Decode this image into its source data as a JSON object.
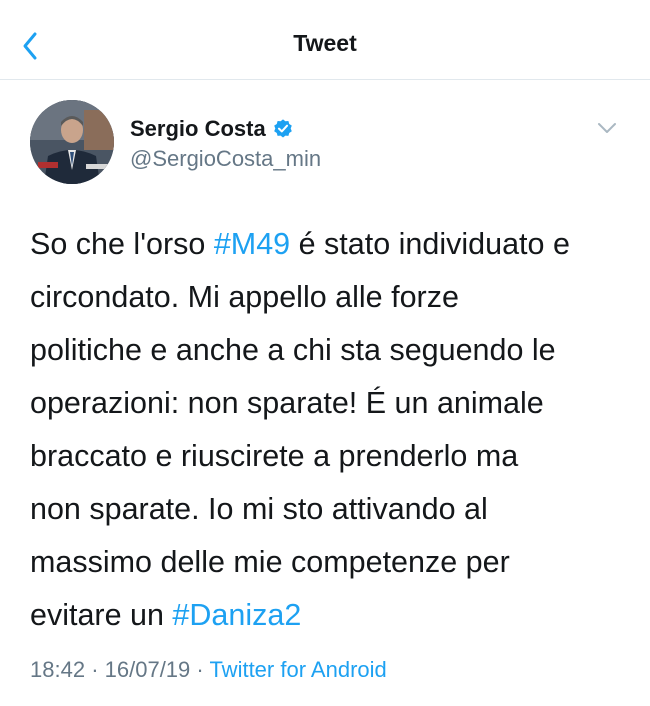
{
  "header": {
    "title": "Tweet"
  },
  "author": {
    "display_name": "Sergio Costa",
    "handle": "@SergioCosta_min",
    "verified": true
  },
  "tweet": {
    "lines": [
      {
        "pre": "So che l'orso ",
        "tag": "#M49",
        "post": " é stato individuato e"
      },
      {
        "pre": "circondato. Mi appello alle forze",
        "tag": "",
        "post": ""
      },
      {
        "pre": "politiche e anche a chi sta seguendo le",
        "tag": "",
        "post": ""
      },
      {
        "pre": "operazioni: non sparate! É un animale",
        "tag": "",
        "post": ""
      },
      {
        "pre": "braccato e riuscirete a prenderlo ma",
        "tag": "",
        "post": ""
      },
      {
        "pre": "non sparate. Io mi sto attivando al",
        "tag": "",
        "post": ""
      },
      {
        "pre": "massimo delle mie competenze per",
        "tag": "",
        "post": ""
      },
      {
        "pre": "evitare un ",
        "tag": "#Daniza2",
        "post": ""
      }
    ]
  },
  "meta": {
    "time": "18:42",
    "separator": "·",
    "date": "16/07/19",
    "source": "Twitter for Android"
  },
  "colors": {
    "accent": "#1da1f2",
    "text": "#14171a",
    "muted": "#657786",
    "divider": "#e1e8ed"
  },
  "icons": {
    "back": "chevron-left-icon",
    "verified": "verified-badge-icon",
    "menu": "chevron-down-icon"
  }
}
